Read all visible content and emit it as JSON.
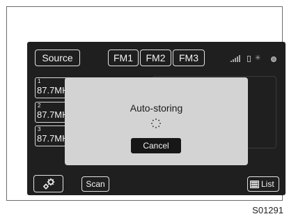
{
  "header": {
    "source_label": "Source",
    "bands": [
      "FM1",
      "FM2",
      "FM3"
    ]
  },
  "status_icons": [
    "signal-bars-icon",
    "phone-battery-icon",
    "bluetooth-icon",
    "record-icon"
  ],
  "presets": [
    {
      "number": "1",
      "frequency": "87.7MHz"
    },
    {
      "number": "2",
      "frequency": "87.7MHz"
    },
    {
      "number": "3",
      "frequency": "87.7MHz"
    }
  ],
  "footer": {
    "gear_icon": "gear-icon",
    "scan_label": "Scan",
    "list_label": "List",
    "list_icon": "list-icon"
  },
  "dialog": {
    "message": "Auto-storing",
    "cancel_label": "Cancel",
    "spinner_icon": "loading-spinner-icon"
  },
  "caption": "S01291",
  "colors": {
    "screen_background": "#1f1f1f",
    "dialog_background": "#d3d3d3",
    "button_border": "#e2e2e2"
  }
}
